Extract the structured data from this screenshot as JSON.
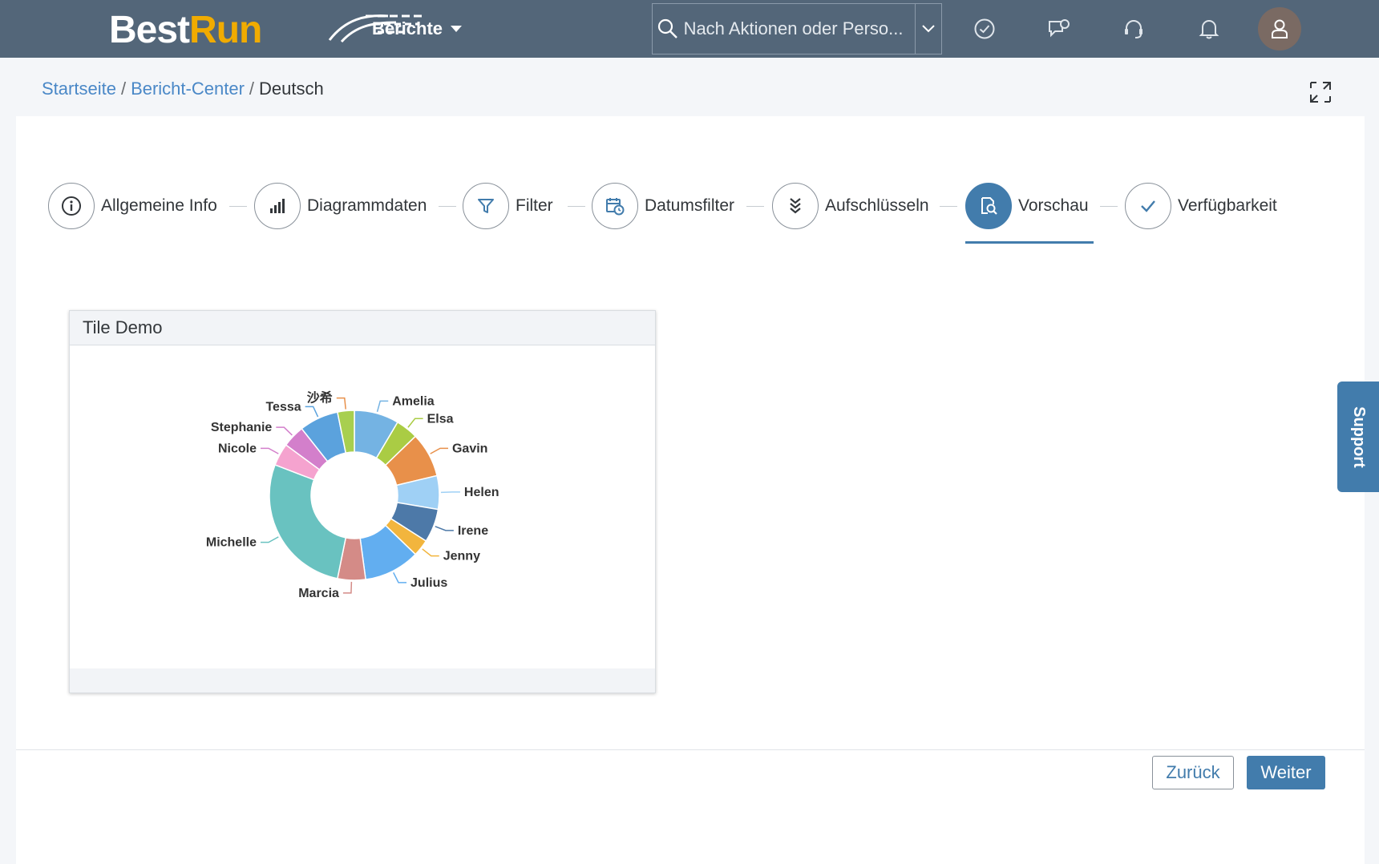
{
  "shell": {
    "logo_best": "Best",
    "logo_run": "Run",
    "menu_label": "Berichte",
    "search_placeholder": "Nach Aktionen oder Perso..."
  },
  "breadcrumb": {
    "home": "Startseite",
    "center": "Bericht-Center",
    "current": "Deutsch",
    "separator": "/"
  },
  "wizard": {
    "steps": [
      {
        "label": "Allgemeine Info",
        "icon": "info-icon"
      },
      {
        "label": "Diagrammdaten",
        "icon": "bar-chart-icon"
      },
      {
        "label": "Filter",
        "icon": "filter-icon"
      },
      {
        "label": "Datumsfilter",
        "icon": "calendar-clock-icon"
      },
      {
        "label": "Aufschlüsseln",
        "icon": "drill-down-icon"
      },
      {
        "label": "Vorschau",
        "icon": "preview-search-icon",
        "active": true
      },
      {
        "label": "Verfügbarkeit",
        "icon": "checkmark-icon"
      }
    ]
  },
  "tile": {
    "title": "Tile Demo"
  },
  "chart_data": {
    "type": "pie",
    "donut": true,
    "title": "",
    "categories": [
      "Amelia",
      "Elsa",
      "Gavin",
      "Helen",
      "Irene",
      "Jenny",
      "Julius",
      "Marcia",
      "Michelle",
      "Nicole",
      "Stephanie",
      "Tessa",
      "沙希"
    ],
    "values": [
      8,
      4,
      8,
      6,
      6,
      3,
      10,
      5,
      26,
      4,
      4,
      7,
      3
    ],
    "colors": [
      "#74b3e3",
      "#aacc44",
      "#e8904a",
      "#9fd0f5",
      "#4d79a8",
      "#f2b53d",
      "#62aef0",
      "#d48b87",
      "#69c2c0",
      "#f5a3cf",
      "#d37fcb",
      "#5ba2dd",
      "#a8cf4f"
    ],
    "label_colors": [
      "#74b3e3",
      "#aacc44",
      "#e8904a",
      "#9fd0f5",
      "#4d79a8",
      "#f2b53d",
      "#62aef0",
      "#d48b87",
      "#69c2c0",
      "#d37fcb",
      "#d37fcb",
      "#5ba2dd",
      "#e8904a"
    ]
  },
  "buttons": {
    "back": "Zurück",
    "next": "Weiter"
  },
  "support_label": "Support"
}
